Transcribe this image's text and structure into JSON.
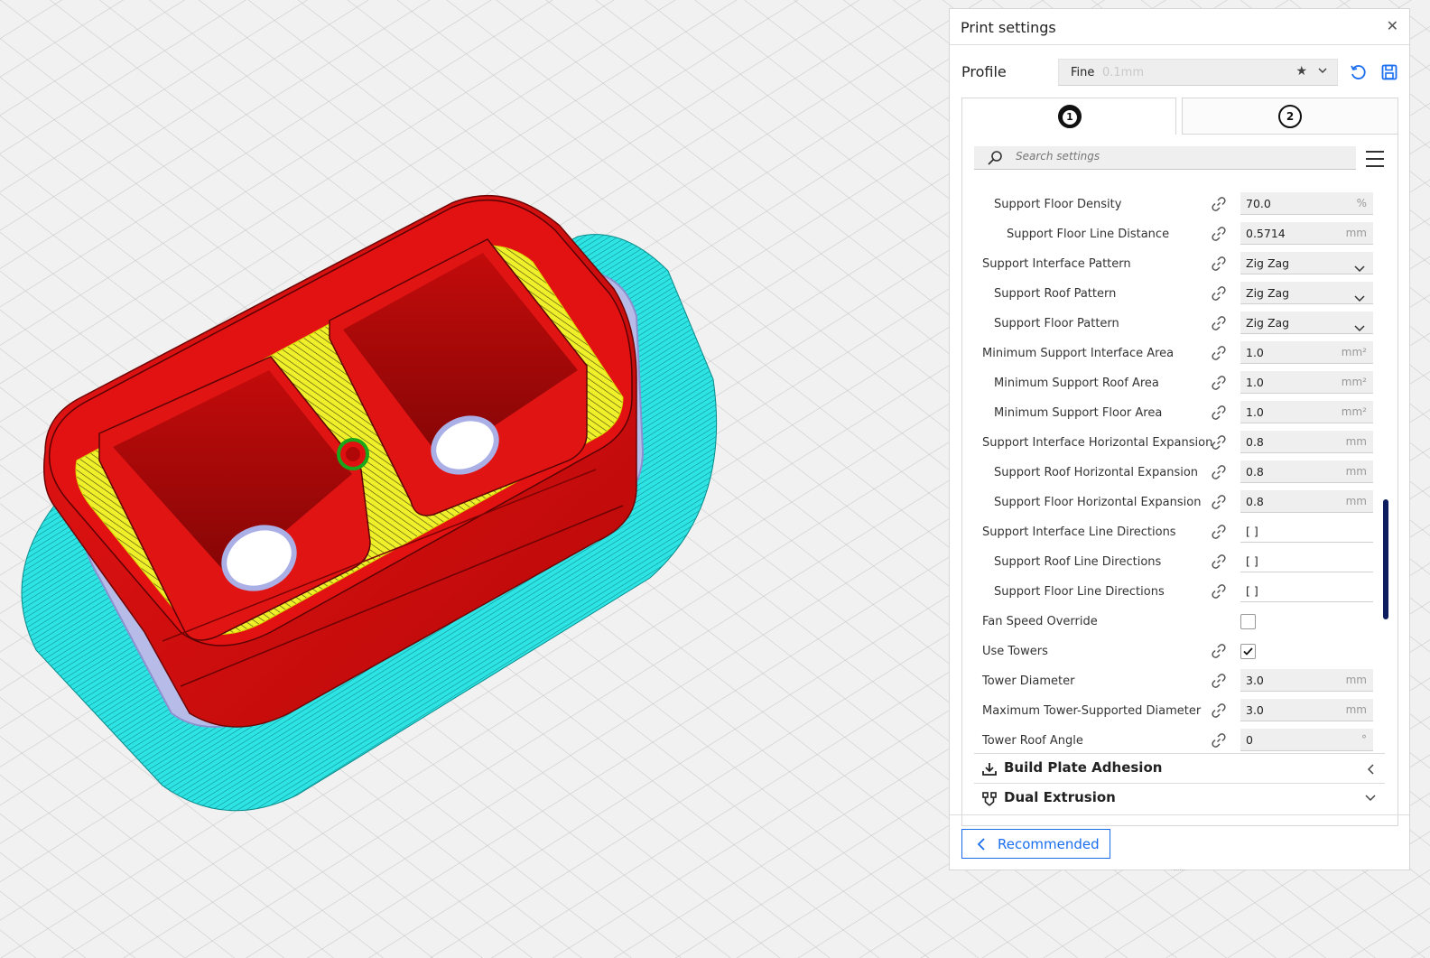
{
  "panel": {
    "title": "Print settings",
    "profile_label": "Profile",
    "profile_name": "Fine",
    "profile_detail": "0.1mm",
    "extruder_tabs": [
      "1",
      "2"
    ],
    "search_placeholder": "Search settings"
  },
  "settings": [
    {
      "label": "Support Floor Density",
      "value": "70.0",
      "unit": "%"
    },
    {
      "label": "Support Floor Line Distance",
      "value": "0.5714",
      "unit": "mm"
    },
    {
      "label": "Support Interface Pattern",
      "value": "Zig Zag",
      "unit": ""
    },
    {
      "label": "Support Roof Pattern",
      "value": "Zig Zag",
      "unit": ""
    },
    {
      "label": "Support Floor Pattern",
      "value": "Zig Zag",
      "unit": ""
    },
    {
      "label": "Minimum Support Interface Area",
      "value": "1.0",
      "unit": "mm²"
    },
    {
      "label": "Minimum Support Roof Area",
      "value": "1.0",
      "unit": "mm²"
    },
    {
      "label": "Minimum Support Floor Area",
      "value": "1.0",
      "unit": "mm²"
    },
    {
      "label": "Support Interface Horizontal Expansion",
      "value": "0.8",
      "unit": "mm"
    },
    {
      "label": "Support Roof Horizontal Expansion",
      "value": "0.8",
      "unit": "mm"
    },
    {
      "label": "Support Floor Horizontal Expansion",
      "value": "0.8",
      "unit": "mm"
    },
    {
      "label": "Support Interface Line Directions",
      "value": "[ ]",
      "unit": ""
    },
    {
      "label": "Support Roof Line Directions",
      "value": "[ ]",
      "unit": ""
    },
    {
      "label": "Support Floor Line Directions",
      "value": "[ ]",
      "unit": ""
    },
    {
      "label": "Fan Speed Override",
      "value": "unchecked",
      "unit": ""
    },
    {
      "label": "Use Towers",
      "value": "checked",
      "unit": ""
    },
    {
      "label": "Tower Diameter",
      "value": "3.0",
      "unit": "mm"
    },
    {
      "label": "Maximum Tower-Supported Diameter",
      "value": "3.0",
      "unit": "mm"
    },
    {
      "label": "Tower Roof Angle",
      "value": "0",
      "unit": "°"
    }
  ],
  "categories": [
    {
      "label": "Build Plate Adhesion",
      "icon": "build-plate-icon",
      "state": "collapsed"
    },
    {
      "label": "Dual Extrusion",
      "icon": "dual-extrusion-icon",
      "state": "expanded"
    }
  ],
  "footer": {
    "recommended_label": "Recommended"
  },
  "colors": {
    "accent": "#196ef0",
    "scrollbar": "#0e1c60",
    "wall": "#e01010",
    "infill": "#f2f22a",
    "skirt": "#28e0e0",
    "support": "#aab0e6"
  }
}
